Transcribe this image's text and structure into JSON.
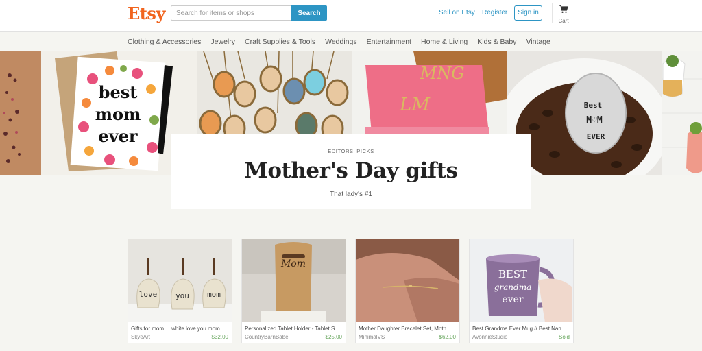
{
  "header": {
    "logo": "Etsy",
    "search_placeholder": "Search for items or shops",
    "search_button": "Search",
    "sell_link": "Sell on Etsy",
    "register_link": "Register",
    "signin_button": "Sign in",
    "cart_label": "Cart"
  },
  "nav": {
    "items": [
      "Clothing & Accessories",
      "Jewelry",
      "Craft Supplies & Tools",
      "Weddings",
      "Entertainment",
      "Home & Living",
      "Kids & Baby",
      "Vintage"
    ]
  },
  "hero": {
    "kicker": "EDITORS' PICKS",
    "title": "Mother's Day gifts",
    "subtitle": "That lady's #1",
    "card_text": [
      "best",
      "mom",
      "ever"
    ],
    "spoon_text": [
      "Best",
      "M♡M",
      "EVER"
    ]
  },
  "products": [
    {
      "title": "Gifts for mom ... white love you mom...",
      "shop": "SkyeArt",
      "price": "$32.00",
      "image_text": [
        "love",
        "you",
        "mom"
      ]
    },
    {
      "title": "Personalized Tablet Holder - Tablet S...",
      "shop": "CountryBarnBabe",
      "price": "$25.00",
      "image_text": [
        "Mom"
      ]
    },
    {
      "title": "Mother Daughter Bracelet Set, Moth...",
      "shop": "MinimalVS",
      "price": "$62.00"
    },
    {
      "title": "Best Grandma Ever Mug // Best Nan...",
      "shop": "AvonnieStudio",
      "price": "Sold",
      "image_text": [
        "BEST",
        "grandma",
        "ever"
      ]
    }
  ],
  "colors": {
    "brand": "#f1641e",
    "link": "#2d95c4",
    "price": "#68a65e",
    "page_bg": "#f5f5f1"
  }
}
